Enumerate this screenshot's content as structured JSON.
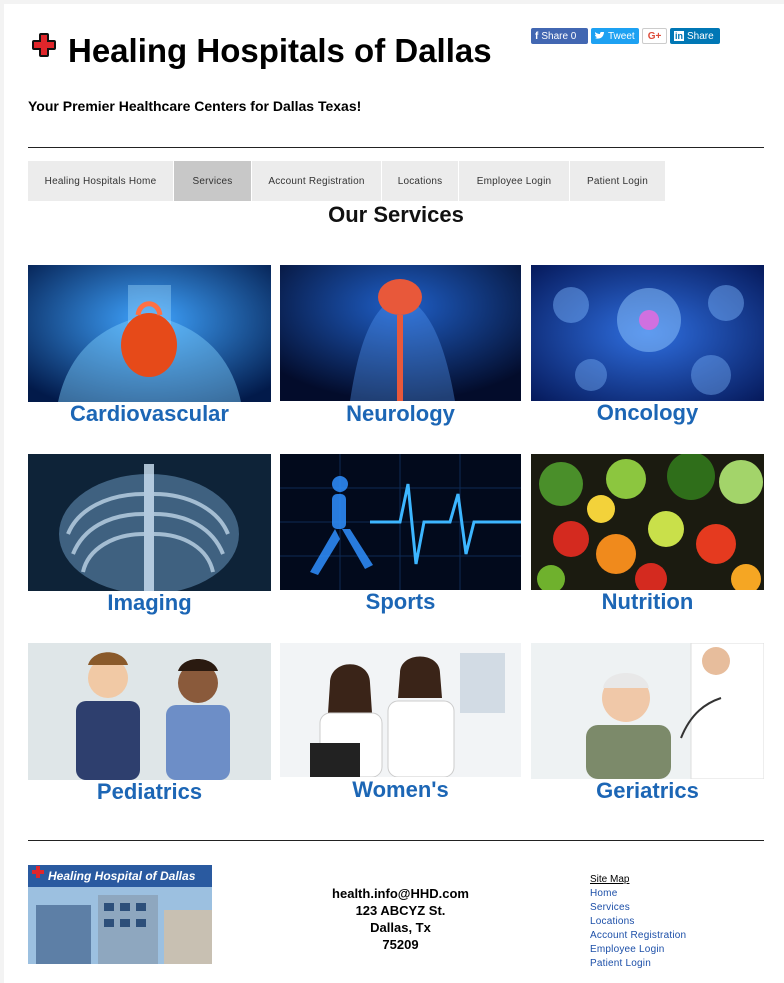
{
  "header": {
    "title": "Healing Hospitals of Dallas",
    "tagline": "Your Premier Healthcare Centers for Dallas Texas!",
    "brand_color": "#e0262b"
  },
  "share": {
    "facebook": "Share 0",
    "twitter": "Tweet",
    "googleplus": "G+",
    "linkedin": "Share",
    "facebook_icon": "f",
    "twitter_icon": "❧",
    "linkedin_icon": "in"
  },
  "nav": {
    "items": [
      {
        "label": "Healing Hospitals Home",
        "active": false
      },
      {
        "label": "Services",
        "active": true
      },
      {
        "label": "Account Registration",
        "active": false
      },
      {
        "label": "Locations",
        "active": false
      },
      {
        "label": "Employee Login",
        "active": false
      },
      {
        "label": "Patient Login",
        "active": false
      }
    ]
  },
  "main": {
    "title": "Our Services",
    "services": [
      {
        "label": "Cardiovascular",
        "image": "heart-anatomy"
      },
      {
        "label": "Neurology",
        "image": "brain-spine"
      },
      {
        "label": "Oncology",
        "image": "cells"
      },
      {
        "label": "Imaging",
        "image": "chest-xray"
      },
      {
        "label": "Sports",
        "image": "runner-ecg"
      },
      {
        "label": "Nutrition",
        "image": "fruits-vegetables"
      },
      {
        "label": "Pediatrics",
        "image": "kids-doctors"
      },
      {
        "label": "Women's",
        "image": "women-doctors"
      },
      {
        "label": "Geriatrics",
        "image": "elderly-patient"
      }
    ],
    "label_color": "#1c66b5"
  },
  "footer": {
    "logo_text": "Healing Hospital of Dallas",
    "email": "health.info@HHD.com",
    "street": "123 ABCYZ St.",
    "city": "Dallas, Tx",
    "zip": "75209",
    "sitemap_heading": "Site Map",
    "sitemap_links": [
      "Home",
      "Services",
      "Locations",
      "Account Registration",
      "Employee Login",
      "Patient Login"
    ]
  }
}
